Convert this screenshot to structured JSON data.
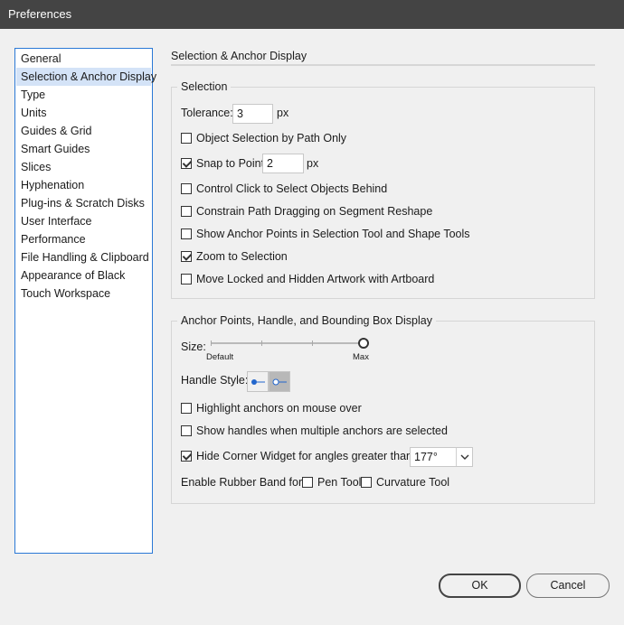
{
  "window": {
    "title": "Preferences"
  },
  "sidebar": {
    "items": [
      {
        "label": "General"
      },
      {
        "label": "Selection & Anchor Display",
        "selected": true
      },
      {
        "label": "Type"
      },
      {
        "label": "Units"
      },
      {
        "label": "Guides & Grid"
      },
      {
        "label": "Smart Guides"
      },
      {
        "label": "Slices"
      },
      {
        "label": "Hyphenation"
      },
      {
        "label": "Plug-ins & Scratch Disks"
      },
      {
        "label": "User Interface"
      },
      {
        "label": "Performance"
      },
      {
        "label": "File Handling & Clipboard"
      },
      {
        "label": "Appearance of Black"
      },
      {
        "label": "Touch Workspace"
      }
    ]
  },
  "main": {
    "section_title": "Selection & Anchor Display"
  },
  "selection": {
    "legend": "Selection",
    "tolerance_label": "Tolerance:",
    "tolerance_value": "3",
    "tolerance_unit": "px",
    "object_by_path": {
      "label": "Object Selection by Path Only",
      "checked": false
    },
    "snap_to_point": {
      "label": "Snap to Point",
      "checked": true,
      "value": "2",
      "unit": "px"
    },
    "control_click": {
      "label": "Control Click to Select Objects Behind",
      "checked": false
    },
    "constrain_path": {
      "label": "Constrain Path Dragging on Segment Reshape",
      "checked": false
    },
    "show_anchor_points": {
      "label": "Show Anchor Points in Selection Tool and Shape Tools",
      "checked": false
    },
    "zoom_to_selection": {
      "label": "Zoom to Selection",
      "checked": true
    },
    "move_locked": {
      "label": "Move Locked and Hidden Artwork with Artboard",
      "checked": false
    }
  },
  "anchor": {
    "legend": "Anchor Points, Handle, and Bounding Box Display",
    "size_label": "Size:",
    "size_min_label": "Default",
    "size_max_label": "Max",
    "size_level": 1.0,
    "handle_style_label": "Handle Style:",
    "handle_styles": [
      {
        "icon": "solid-handle-icon",
        "selected": false
      },
      {
        "icon": "hollow-handle-icon",
        "selected": true
      }
    ],
    "highlight_anchors": {
      "label": "Highlight anchors on mouse over",
      "checked": false
    },
    "show_handles_multiple": {
      "label": "Show handles when multiple anchors are selected",
      "checked": false
    },
    "hide_corner_widget": {
      "label": "Hide Corner Widget for angles greater than:",
      "checked": true,
      "value": "177°"
    },
    "rubber_band_label": "Enable Rubber Band for:",
    "pen_tool": {
      "label": "Pen Tool",
      "checked": false
    },
    "curvature_tool": {
      "label": "Curvature Tool",
      "checked": false
    }
  },
  "footer": {
    "ok_label": "OK",
    "cancel_label": "Cancel"
  },
  "colors": {
    "titlebar": "#444444",
    "sidebar_border": "#2a78d6",
    "sidebar_selected": "#d4e3f7",
    "background": "#f0f0f0"
  }
}
